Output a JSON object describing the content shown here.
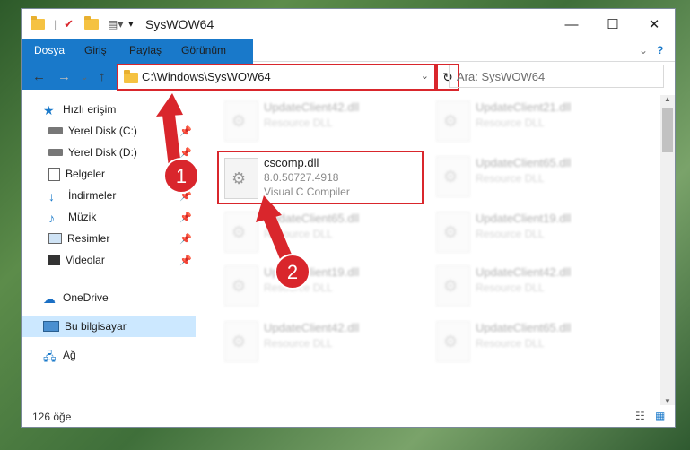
{
  "window": {
    "title": "SysWOW64"
  },
  "controls": {
    "minimize": "—",
    "maximize": "☐",
    "close": "✕"
  },
  "ribbon": {
    "tabs": [
      "Dosya",
      "Giriş",
      "Paylaş",
      "Görünüm"
    ]
  },
  "address": {
    "path": "C:\\Windows\\SysWOW64",
    "search_placeholder": "Ara: SysWOW64"
  },
  "nav": {
    "items": [
      {
        "label": "Hızlı erişim",
        "pinned": false
      },
      {
        "label": "Yerel Disk (C:)",
        "pinned": true
      },
      {
        "label": "Yerel Disk (D:)",
        "pinned": true
      },
      {
        "label": "Belgeler",
        "pinned": true
      },
      {
        "label": "İndirmeler",
        "pinned": true
      },
      {
        "label": "Müzik",
        "pinned": true
      },
      {
        "label": "Resimler",
        "pinned": true
      },
      {
        "label": "Videolar",
        "pinned": true
      },
      {
        "label": "OneDrive",
        "pinned": false
      },
      {
        "label": "Bu bilgisayar",
        "pinned": false,
        "selected": true
      },
      {
        "label": "Ağ",
        "pinned": false
      }
    ]
  },
  "files": {
    "highlighted": {
      "name": "cscomp.dll",
      "version": "8.0.50727.4918",
      "desc": "Visual C Compiler"
    },
    "others": [
      {
        "name": "UpdateClient42.dll",
        "desc": "Resource DLL"
      },
      {
        "name": "UpdateClient21.dll",
        "desc": "Resource DLL"
      },
      {
        "name": "UpdateClient65.dll",
        "desc": "Resource DLL"
      },
      {
        "name": "UpdateClient65.dll",
        "desc": "Resource DLL"
      },
      {
        "name": "UpdateClient19.dll",
        "desc": "Resource DLL"
      },
      {
        "name": "UpdateClient19.dll",
        "desc": "Resource DLL"
      },
      {
        "name": "UpdateClient42.dll",
        "desc": "Resource DLL"
      },
      {
        "name": "UpdateClient42.dll",
        "desc": "Resource DLL"
      },
      {
        "name": "UpdateClient65.dll",
        "desc": "Resource DLL"
      }
    ]
  },
  "status": {
    "count": "126 öğe"
  },
  "annotations": {
    "step1": "1",
    "step2": "2"
  }
}
